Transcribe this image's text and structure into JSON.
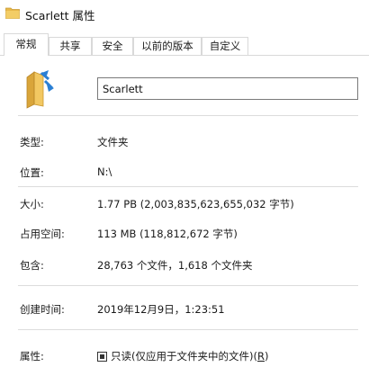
{
  "window": {
    "title": "Scarlett 属性",
    "icon": "folder-icon"
  },
  "tabs": [
    {
      "label": "常规",
      "active": true
    },
    {
      "label": "共享",
      "active": false
    },
    {
      "label": "安全",
      "active": false
    },
    {
      "label": "以前的版本",
      "active": false
    },
    {
      "label": "自定义",
      "active": false
    }
  ],
  "general": {
    "icon": "shared-folder-icon",
    "name_value": "Scarlett",
    "type_label": "类型:",
    "type_value": "文件夹",
    "location_label": "位置:",
    "location_value": "N:\\",
    "size_label": "大小:",
    "size_value": "1.77 PB (2,003,835,623,655,032 字节)",
    "size_on_disk_label": "占用空间:",
    "size_on_disk_value": "113 MB (118,812,672 字节)",
    "contains_label": "包含:",
    "contains_value": "28,763 个文件，1,618 个文件夹",
    "created_label": "创建时间:",
    "created_value": "2019年12月9日，1:23:51",
    "attributes_label": "属性:",
    "readonly_label": "只读(仅应用于文件夹中的文件)",
    "readonly_accel": "R",
    "readonly_state": "indeterminate"
  },
  "colors": {
    "folder_yellow": "#E8B84A",
    "folder_dark": "#D19A2A",
    "share_blue": "#2A7FD4"
  }
}
